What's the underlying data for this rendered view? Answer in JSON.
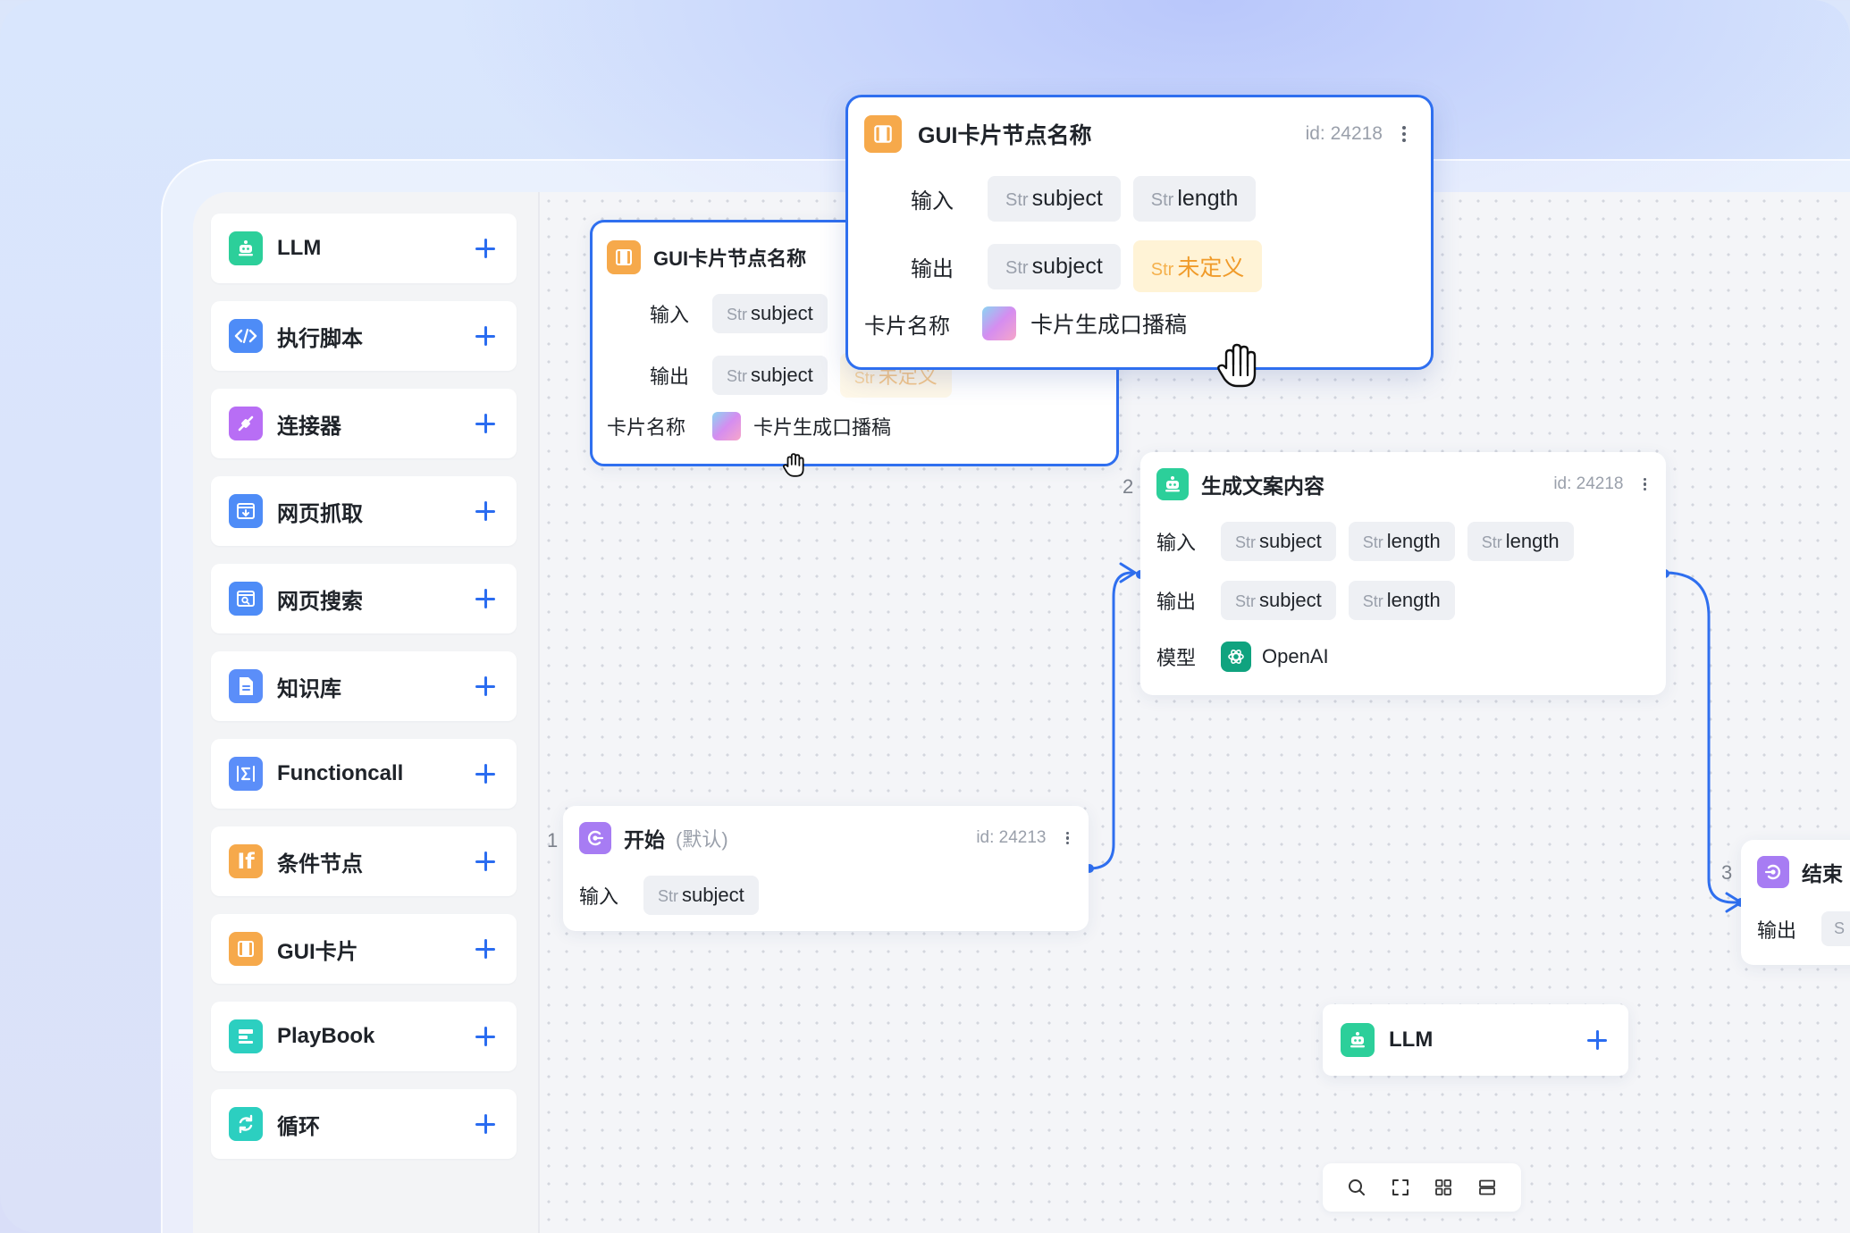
{
  "sidebar": {
    "items": [
      {
        "label": "LLM",
        "icon": "robot-icon",
        "color": "#2ccf9a"
      },
      {
        "label": "执行脚本",
        "icon": "code-icon",
        "color": "#4e8cf7"
      },
      {
        "label": "连接器",
        "icon": "connector-icon",
        "color": "#b86ef5"
      },
      {
        "label": "网页抓取",
        "icon": "web-crawl-icon",
        "color": "#4e8cf7"
      },
      {
        "label": "网页搜索",
        "icon": "web-search-icon",
        "color": "#4e8cf7"
      },
      {
        "label": "知识库",
        "icon": "document-icon",
        "color": "#5b8ef9"
      },
      {
        "label": "Functioncall",
        "icon": "sigma-icon",
        "color": "#5b8ef9"
      },
      {
        "label": "条件节点",
        "icon": "if-icon",
        "glyph": "If",
        "color": "#f6a94b"
      },
      {
        "label": "GUI卡片",
        "icon": "card-icon",
        "color": "#f6a94b"
      },
      {
        "label": "PlayBook",
        "icon": "playbook-icon",
        "color": "#2ccfc0"
      },
      {
        "label": "循环",
        "icon": "loop-icon",
        "color": "#2ccfc0"
      }
    ]
  },
  "common": {
    "input_label": "输入",
    "output_label": "输出",
    "card_name_label": "卡片名称",
    "model_label": "模型",
    "type_prefix": "Str"
  },
  "gui_node": {
    "title": "GUI卡片节点名称",
    "id_label": "id: 24218",
    "inputs": [
      "subject",
      "length"
    ],
    "outputs": [
      "subject",
      "未定义"
    ],
    "card_name": "卡片生成口播稿"
  },
  "gui_node_ghost": {
    "title": "GUI卡片节点名称",
    "inputs": [
      "subject"
    ],
    "outputs": [
      "subject",
      "未定义"
    ],
    "card_name": "卡片生成口播稿"
  },
  "gen_node": {
    "step": "2",
    "title": "生成文案内容",
    "id_label": "id: 24218",
    "inputs": [
      "subject",
      "length",
      "length"
    ],
    "outputs": [
      "subject",
      "length"
    ],
    "model": "OpenAI"
  },
  "start_node": {
    "step": "1",
    "title": "开始",
    "subtitle": "(默认)",
    "id_label": "id: 24213",
    "inputs": [
      "subject"
    ]
  },
  "end_node": {
    "step": "3",
    "title": "结束",
    "output_prefix": "S"
  },
  "drag_node": {
    "label": "LLM"
  },
  "colors": {
    "accent": "#2f6fef",
    "warning": "#f09b2a"
  }
}
